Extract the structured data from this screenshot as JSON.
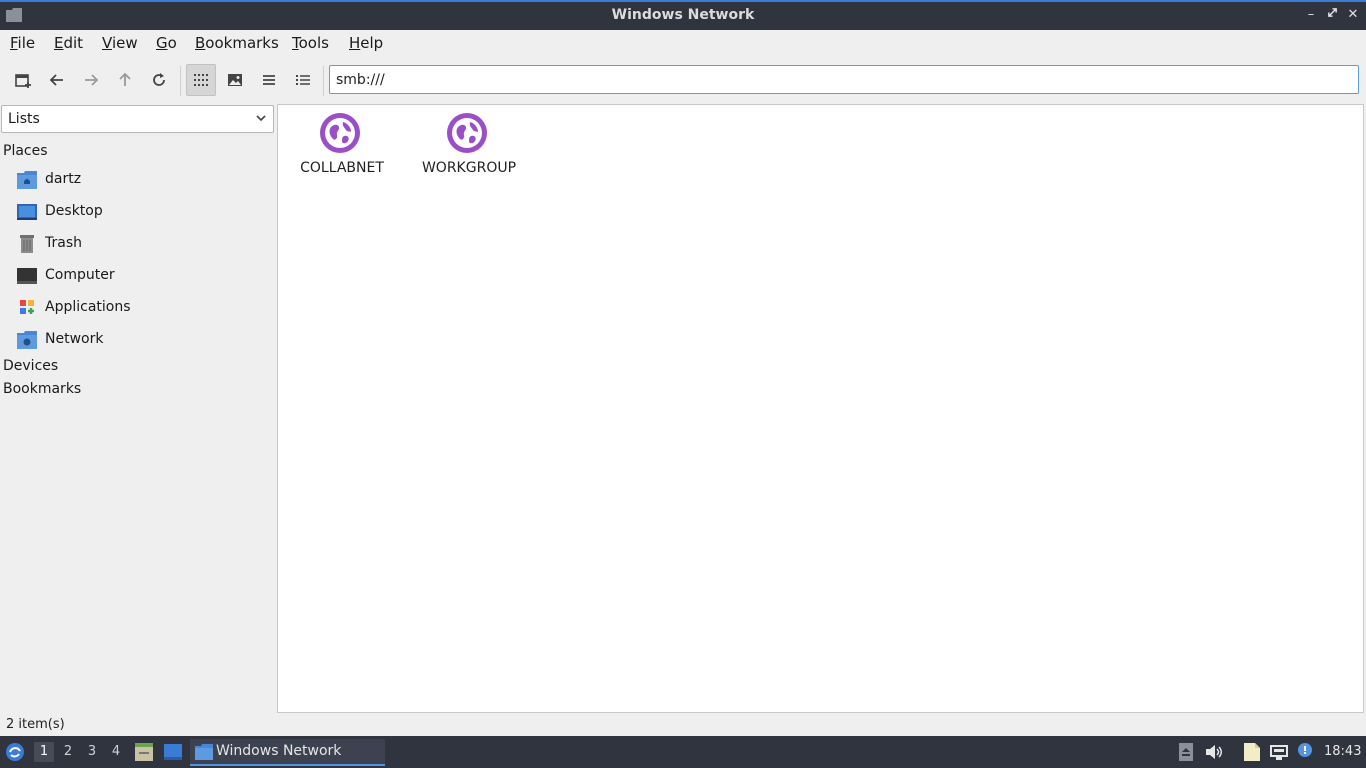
{
  "window": {
    "title": "Windows Network",
    "minimize_icon": "minimize-icon",
    "maximize_icon": "maximize-icon",
    "close_icon": "close-icon"
  },
  "menubar": {
    "items": [
      {
        "label": "File",
        "accel": "F",
        "rest": "ile"
      },
      {
        "label": "Edit",
        "accel": "E",
        "rest": "dit"
      },
      {
        "label": "View",
        "accel": "V",
        "rest": "iew"
      },
      {
        "label": "Go",
        "accel": "G",
        "rest": "o"
      },
      {
        "label": "Bookmarks",
        "accel": "B",
        "rest": "ookmarks"
      },
      {
        "label": "Tools",
        "accel": "T",
        "rest": "ools"
      },
      {
        "label": "Help",
        "accel": "H",
        "rest": "elp"
      }
    ]
  },
  "toolbar": {
    "buttons": [
      "new-tab-icon",
      "back-icon",
      "forward-icon",
      "up-icon",
      "reload-icon",
      "icon-view-icon",
      "thumbnail-view-icon",
      "compact-view-icon",
      "detail-list-icon"
    ],
    "location": "smb:///"
  },
  "sidepane": {
    "mode": "Lists",
    "sections": {
      "places": "Places",
      "devices": "Devices",
      "bookmarks": "Bookmarks"
    },
    "places": [
      {
        "label": "dartz",
        "icon": "home-folder-icon"
      },
      {
        "label": "Desktop",
        "icon": "desktop-icon"
      },
      {
        "label": "Trash",
        "icon": "trash-icon"
      },
      {
        "label": "Computer",
        "icon": "computer-icon"
      },
      {
        "label": "Applications",
        "icon": "applications-icon"
      },
      {
        "label": "Network",
        "icon": "network-folder-icon"
      }
    ]
  },
  "main": {
    "items": [
      {
        "name": "COLLABNET",
        "icon": "network-workgroup-icon"
      },
      {
        "name": "WORKGROUP",
        "icon": "network-workgroup-icon"
      }
    ]
  },
  "status": {
    "text": "2 item(s)"
  },
  "taskbar": {
    "workspaces": [
      "1",
      "2",
      "3",
      "4"
    ],
    "active_workspace": "1",
    "task_label": "Windows Network",
    "clock": "18:43"
  },
  "colors": {
    "accent": "#5294e2",
    "titlebar_bg": "#2f343f",
    "globe": "#9b4fc7"
  }
}
